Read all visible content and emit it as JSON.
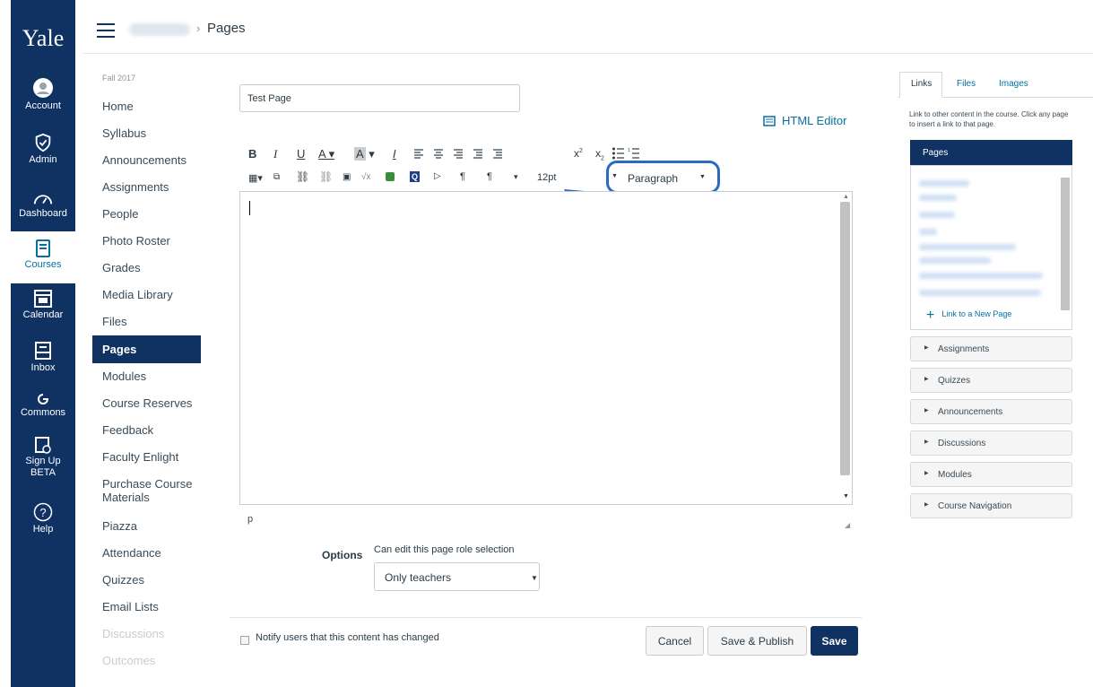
{
  "global_nav": {
    "logo": "Yale",
    "items": [
      {
        "label": "Account"
      },
      {
        "label": "Admin"
      },
      {
        "label": "Dashboard"
      },
      {
        "label": "Courses"
      },
      {
        "label": "Calendar"
      },
      {
        "label": "Inbox"
      },
      {
        "label": "Commons"
      },
      {
        "label": "Sign Up BETA"
      },
      {
        "label": "Help"
      }
    ]
  },
  "breadcrumb": {
    "separator": "›",
    "current": "Pages"
  },
  "course_nav": {
    "term": "Fall 2017",
    "items": [
      "Home",
      "Syllabus",
      "Announcements",
      "Assignments",
      "People",
      "Photo Roster",
      "Grades",
      "Media Library",
      "Files",
      "Pages",
      "Modules",
      "Course Reserves",
      "Feedback",
      "Faculty Enlight",
      "Purchase Course Materials",
      "Piazza",
      "Attendance",
      "Quizzes",
      "Email Lists",
      "Discussions",
      "Outcomes"
    ],
    "active": "Pages"
  },
  "editor": {
    "title_value": "Test Page",
    "html_editor_label": "HTML Editor",
    "font_size": "12pt",
    "format_select": "Paragraph",
    "status_path": "p",
    "options_label": "Options",
    "role_label": "Can edit this page role selection",
    "role_value": "Only teachers",
    "notify_label": "Notify users that this content has changed",
    "buttons": {
      "cancel": "Cancel",
      "save_publish": "Save & Publish",
      "save": "Save"
    }
  },
  "right_panel": {
    "tabs": [
      "Links",
      "Files",
      "Images"
    ],
    "help_text": "Link to other content in the course. Click any page to insert a link to that page.",
    "pages_header": "Pages",
    "new_page": "Link to a New Page",
    "sections": [
      "Assignments",
      "Quizzes",
      "Announcements",
      "Discussions",
      "Modules",
      "Course Navigation"
    ]
  },
  "colors": {
    "nav": "#0f3263",
    "link": "#0770a3",
    "annotation": "#2a6bbf"
  }
}
